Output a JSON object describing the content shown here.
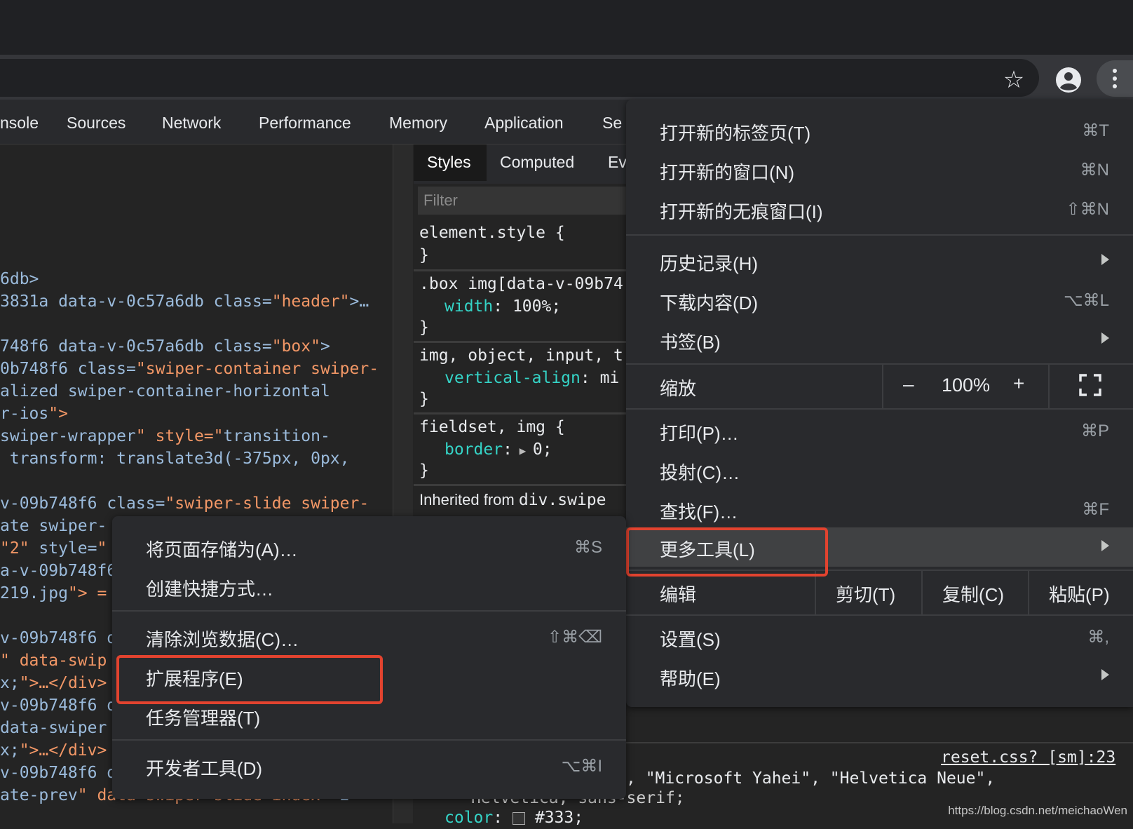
{
  "devtools": {
    "tabs": [
      "nsole",
      "Sources",
      "Network",
      "Performance",
      "Memory",
      "Application",
      "Se"
    ],
    "elements_lines": [
      [
        "6db>"
      ],
      [
        "3831a data-v-0c57a6db class=\"header\">…"
      ],
      [
        ""
      ],
      [
        "748f6 data-v-0c57a6db class=\"box\">"
      ],
      [
        "0b748f6 class=\"swiper-container swiper-"
      ],
      [
        "alized swiper-container-horizontal"
      ],
      [
        "r-ios\">"
      ],
      [
        "swiper-wrapper\" style=\"transition-"
      ],
      [
        " transform: translate3d(-375px, 0px,"
      ],
      [
        ""
      ],
      [
        "v-09b748f6 class=\"swiper-slide swiper-"
      ],
      [
        "ate swiper-"
      ],
      [
        "\"2\" style=\""
      ],
      [
        "a-v-09b748f6"
      ],
      [
        "219.jpg\"> ="
      ],
      [
        ""
      ],
      [
        "v-09b748f6 d"
      ],
      [
        "\" data-swip"
      ],
      [
        "x;\">…</div>"
      ],
      [
        "v-09b748f6 d"
      ],
      [
        "data-swiper"
      ],
      [
        "x;\">…</div>"
      ],
      [
        "v-09b748f6 d"
      ],
      [
        "ate-prev\" data-swiper-slide-index=\"2\""
      ]
    ],
    "styles": {
      "tabs": [
        "Styles",
        "Computed",
        "Ev"
      ],
      "filter_placeholder": "Filter",
      "rules": [
        {
          "selector": "element.style {",
          "props": [],
          "close": "}"
        },
        {
          "selector": ".box img[data-v-09b74",
          "props": [
            [
              "width",
              "100%;"
            ]
          ],
          "close": "}"
        },
        {
          "selector": "img, object, input, t",
          "props": [
            [
              "vertical-align",
              "mi"
            ]
          ],
          "close": "}"
        },
        {
          "selector": "fieldset, img {",
          "props": [
            [
              "border",
              "0;"
            ]
          ],
          "close": "}"
        }
      ],
      "inherited_label": "Inherited from",
      "inherited_selector": "div.swipe",
      "source_link": "reset.css? [sm]:23",
      "font_line": ", \"Microsoft Yahei\", \"Helvetica Neue\",",
      "font_line2": "Helvetica, sans-serif;",
      "color_prop": "color",
      "color_val": "#333;"
    }
  },
  "main_menu": {
    "items": [
      {
        "label": "打开新的标签页(T)",
        "shortcut": "⌘T"
      },
      {
        "label": "打开新的窗口(N)",
        "shortcut": "⌘N"
      },
      {
        "label": "打开新的无痕窗口(I)",
        "shortcut": "⇧⌘N"
      },
      {
        "label": "历史记录(H)",
        "submenu": true
      },
      {
        "label": "下载内容(D)",
        "shortcut": "⌥⌘L"
      },
      {
        "label": "书签(B)",
        "submenu": true
      },
      {
        "label": "打印(P)…",
        "shortcut": "⌘P"
      },
      {
        "label": "投射(C)…"
      },
      {
        "label": "查找(F)…",
        "shortcut": "⌘F"
      },
      {
        "label": "更多工具(L)",
        "submenu": true
      },
      {
        "label": "设置(S)",
        "shortcut": "⌘,"
      },
      {
        "label": "帮助(E)",
        "submenu": true
      }
    ],
    "zoom": {
      "label": "缩放",
      "minus": "–",
      "value": "100%",
      "plus": "+"
    },
    "edit": {
      "label": "编辑",
      "cut": "剪切(T)",
      "copy": "复制(C)",
      "paste": "粘贴(P)"
    }
  },
  "sub_menu": {
    "items": [
      {
        "label": "将页面存储为(A)…",
        "shortcut": "⌘S"
      },
      {
        "label": "创建快捷方式…"
      },
      {
        "label": "清除浏览数据(C)…",
        "shortcut": "⇧⌘⌫"
      },
      {
        "label": "扩展程序(E)"
      },
      {
        "label": "任务管理器(T)"
      },
      {
        "label": "开发者工具(D)",
        "shortcut": "⌥⌘I"
      }
    ]
  },
  "watermark": "https://blog.csdn.net/meichaoWen",
  "colors": {
    "highlight_box": "#e2432f",
    "menu_bg": "#292a2d"
  }
}
